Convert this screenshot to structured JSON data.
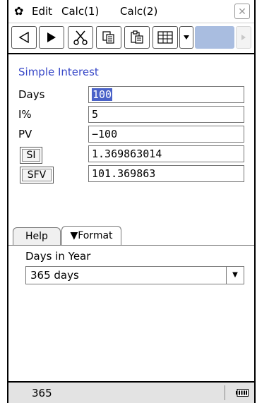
{
  "menubar": {
    "gear_icon": "gear-icon",
    "items": [
      "Edit",
      "Calc(1)",
      "Calc(2)"
    ],
    "close_label": "✕"
  },
  "toolbar": {
    "icons": [
      "back-triangle-icon",
      "play-icon",
      "cut-icon",
      "copy-icon",
      "paste-icon",
      "table-icon",
      "dropdown-arrow-icon",
      "blank-slot",
      "forward-disabled-icon"
    ],
    "highlight_color": "#a9bde0"
  },
  "form": {
    "title": "Simple Interest",
    "title_color": "#3848c8",
    "fields": [
      {
        "label": "Days",
        "value": "100"
      },
      {
        "label": "I%",
        "value": "5"
      },
      {
        "label": "PV",
        "value": "−100"
      }
    ],
    "buttons": [
      {
        "label": "SI",
        "value": "1.369863014"
      },
      {
        "label": "SFV",
        "value": "101.369863"
      }
    ]
  },
  "tabs": {
    "help": "Help",
    "format": "▼Format"
  },
  "format_panel": {
    "days_label": "Days in Year",
    "days_value": "365 days",
    "dropdown_arrow": "▼"
  },
  "status": {
    "text": "365"
  }
}
